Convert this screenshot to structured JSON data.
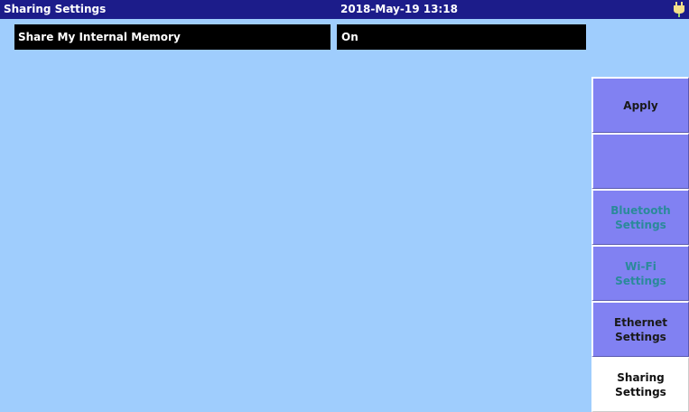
{
  "header": {
    "title": "Sharing Settings",
    "datetime": "2018-May-19 13:18",
    "status_icon": "plug-icon"
  },
  "setting": {
    "label": "Share My Internal Memory",
    "value": "On"
  },
  "softkeys": [
    {
      "label": "Apply",
      "state": "enabled"
    },
    {
      "label": "",
      "state": "empty"
    },
    {
      "label": "Bluetooth\nSettings",
      "state": "disabled"
    },
    {
      "label": "Wi-Fi\nSettings",
      "state": "disabled"
    },
    {
      "label": "Ethernet\nSettings",
      "state": "enabled"
    },
    {
      "label": "Sharing\nSettings",
      "state": "active"
    }
  ],
  "colors": {
    "background": "#9fcdfd",
    "titlebar": "#1c1c8a",
    "softkey": "#8181f2",
    "disabled_text": "#2a8a9a"
  }
}
